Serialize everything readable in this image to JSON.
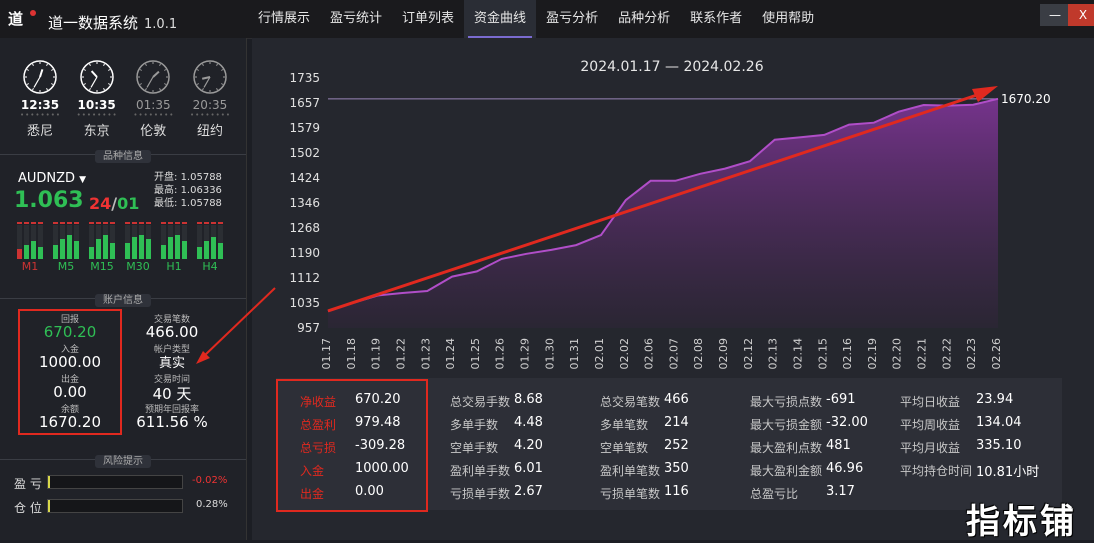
{
  "app": {
    "title": "道一数据系统",
    "version": "1.0.1",
    "logo_text": "道"
  },
  "menu": [
    "行情展示",
    "盈亏统计",
    "订单列表",
    "资金曲线",
    "盈亏分析",
    "品种分析",
    "联系作者",
    "使用帮助"
  ],
  "active_menu": "资金曲线",
  "window_buttons": {
    "minimize": "—",
    "close": "X"
  },
  "clocks": [
    {
      "time": "12:35",
      "city": "悉尼",
      "hour": 12,
      "minute": 35,
      "active": true
    },
    {
      "time": "10:35",
      "city": "东京",
      "hour": 10,
      "minute": 35,
      "active": true
    },
    {
      "time": "01:35",
      "city": "伦敦",
      "hour": 1,
      "minute": 35,
      "active": false
    },
    {
      "time": "20:35",
      "city": "纽约",
      "hour": 20,
      "minute": 35,
      "active": false
    }
  ],
  "symbol_section": {
    "header": "品种信息",
    "symbol": "AUDNZD",
    "price_big": "1.063",
    "price_small_a": "24",
    "price_sep": "/",
    "price_small_b": "01",
    "open_label": "开盘:",
    "open": "1.05788",
    "high_label": "最高:",
    "high": "1.06336",
    "low_label": "最低:",
    "low": "1.05788",
    "timeframes": [
      {
        "label": "M1",
        "color": "#cc3333"
      },
      {
        "label": "M5",
        "color": "#2fbf55"
      },
      {
        "label": "M15",
        "color": "#2fbf55"
      },
      {
        "label": "M30",
        "color": "#2fbf55"
      },
      {
        "label": "H1",
        "color": "#2fbf55"
      },
      {
        "label": "H4",
        "color": "#2fbf55"
      }
    ]
  },
  "account": {
    "header": "账户信息",
    "return_label": "回报",
    "return_value": "670.20",
    "deposit_label": "入金",
    "deposit_value": "1000.00",
    "withdraw_label": "出金",
    "withdraw_value": "0.00",
    "balance_label": "余额",
    "balance_value": "1670.20",
    "trades_label": "交易笔数",
    "trades_value": "466.00",
    "type_label": "帐户类型",
    "type_value": "真实",
    "time_label": "交易时间",
    "time_value": "40 天",
    "annual_label": "预期年回报率",
    "annual_value": "611.56 %"
  },
  "risk": {
    "header": "风险提示",
    "pnl_label": "盈 亏",
    "pnl_value": "-0.02%",
    "pnl_fraction": 0.0002,
    "pos_label": "仓 位",
    "pos_value": "0.28%",
    "pos_fraction": 0.0028
  },
  "chart_data": {
    "type": "area",
    "title": "2024.01.17 — 2024.02.26",
    "x": [
      "01.17",
      "01.18",
      "01.19",
      "01.22",
      "01.23",
      "01.24",
      "01.25",
      "01.26",
      "01.29",
      "01.30",
      "01.31",
      "02.01",
      "02.02",
      "02.06",
      "02.07",
      "02.08",
      "02.09",
      "02.12",
      "02.13",
      "02.14",
      "02.15",
      "02.16",
      "02.19",
      "02.20",
      "02.21",
      "02.22",
      "02.23",
      "02.26"
    ],
    "values": [
      1010,
      1035,
      1058,
      1066,
      1072,
      1117,
      1133,
      1172,
      1188,
      1200,
      1215,
      1246,
      1355,
      1415,
      1415,
      1437,
      1453,
      1476,
      1543,
      1550,
      1558,
      1590,
      1596,
      1630,
      1651,
      1649,
      1652,
      1670.2
    ],
    "yticks": [
      957,
      1035,
      1112,
      1190,
      1268,
      1346,
      1424,
      1502,
      1579,
      1657,
      1735
    ],
    "ylim": [
      957,
      1735
    ],
    "end_label": "1670.20",
    "reference_line": 1670.2,
    "trend_line": [
      1010,
      1679
    ],
    "colors": {
      "line": "#b04ec8",
      "fill": "#5a2a6e",
      "trend": "#e0291f"
    }
  },
  "stats": {
    "col1": [
      {
        "label": "净收益",
        "value": "670.20"
      },
      {
        "label": "总盈利",
        "value": "979.48"
      },
      {
        "label": "总亏损",
        "value": "-309.28"
      },
      {
        "label": "入金",
        "value": "1000.00"
      },
      {
        "label": "出金",
        "value": "0.00"
      }
    ],
    "col2": [
      {
        "label": "总交易手数",
        "value": "8.68"
      },
      {
        "label": "多单手数",
        "value": "4.48"
      },
      {
        "label": "空单手数",
        "value": "4.20"
      },
      {
        "label": "盈利单手数",
        "value": "6.01"
      },
      {
        "label": "亏损单手数",
        "value": "2.67"
      }
    ],
    "col3": [
      {
        "label": "总交易笔数",
        "value": "466"
      },
      {
        "label": "多单笔数",
        "value": "214"
      },
      {
        "label": "空单笔数",
        "value": "252"
      },
      {
        "label": "盈利单笔数",
        "value": "350"
      },
      {
        "label": "亏损单笔数",
        "value": "116"
      }
    ],
    "col4": [
      {
        "label": "最大亏损点数",
        "value": "-691"
      },
      {
        "label": "最大亏损金额",
        "value": "-32.00"
      },
      {
        "label": "最大盈利点数",
        "value": "481"
      },
      {
        "label": "最大盈利金额",
        "value": "46.96"
      },
      {
        "label": "总盈亏比",
        "value": "3.17"
      }
    ],
    "col5": [
      {
        "label": "平均日收益",
        "value": "23.94"
      },
      {
        "label": "平均周收益",
        "value": "134.04"
      },
      {
        "label": "平均月收益",
        "value": "335.10"
      },
      {
        "label": "平均持仓时间",
        "value": "10.81小时"
      }
    ]
  },
  "watermark": "指标铺"
}
